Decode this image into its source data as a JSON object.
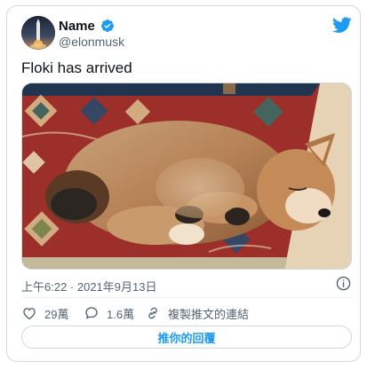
{
  "author": {
    "display_name": "Name",
    "handle": "@elonmusk",
    "verified": true
  },
  "tweet": {
    "text": "Floki has arrived",
    "timestamp": "上午6:22 · 2021年9月13日"
  },
  "actions": {
    "likes": "29萬",
    "replies": "1.6萬",
    "copy_link": "複製推文的連結"
  },
  "reply_button": "推你的回覆",
  "icons": {
    "logo": "twitter-bird-icon",
    "verified": "verified-badge-icon",
    "info": "info-icon",
    "like": "heart-icon",
    "reply": "speech-bubble-icon",
    "copy_link": "link-icon"
  },
  "colors": {
    "accent": "#1d9bf0",
    "text": "#0f1419",
    "muted": "#536471",
    "border": "#cfd9de"
  }
}
